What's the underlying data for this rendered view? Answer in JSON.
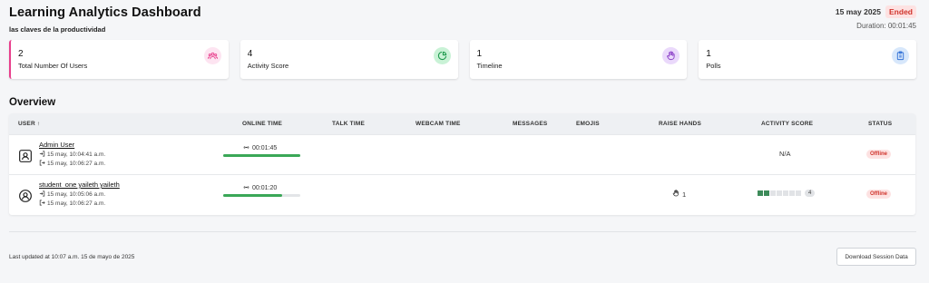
{
  "header": {
    "title": "Learning Analytics Dashboard",
    "subtitle": "las claves de la productividad",
    "date": "15 may 2025",
    "status_badge": "Ended",
    "duration": "Duration: 00:01:45"
  },
  "cards": [
    {
      "value": "2",
      "label": "Total Number Of Users",
      "icon": "users-icon",
      "color": "#e83e8c",
      "bg": "#fde4f1"
    },
    {
      "value": "4",
      "label": "Activity Score",
      "icon": "pie-chart-icon",
      "color": "#1e9a4d",
      "bg": "#c9f2d6"
    },
    {
      "value": "1",
      "label": "Timeline",
      "icon": "raise-hand-icon",
      "color": "#8e44c9",
      "bg": "#ead9fb"
    },
    {
      "value": "1",
      "label": "Polls",
      "icon": "clipboard-icon",
      "color": "#2f6fd6",
      "bg": "#d7e7fb"
    }
  ],
  "overview": {
    "title": "Overview"
  },
  "table": {
    "headers": {
      "user": "USER ↑",
      "online_time": "ONLINE TIME",
      "talk_time": "TALK TIME",
      "webcam_time": "WEBCAM TIME",
      "messages": "MESSAGES",
      "emojis": "EMOJIS",
      "raise_hands": "RAISE HANDS",
      "activity_score": "ACTIVITY SCORE",
      "status": "STATUS"
    },
    "rows": [
      {
        "name": "Admin User",
        "joined": "15 may, 10:04:41 a.m.",
        "left": "15 may, 10:06:27 a.m.",
        "online_time": "00:01:45",
        "online_fraction": 1.0,
        "activity_score": "N/A",
        "status": "Offline"
      },
      {
        "name": "student_one yaileth yaileth",
        "joined": "15 may, 10:05:06 a.m.",
        "left": "15 may, 10:06:27 a.m.",
        "online_time": "00:01:20",
        "online_fraction": 0.77,
        "raise_hands": "1",
        "activity_score": "4",
        "activity_level": 2,
        "activity_max": 7,
        "status": "Offline"
      }
    ]
  },
  "footer": {
    "last_updated": "Last updated at 10:07 a.m. 15 de mayo de 2025",
    "download_label": "Download Session Data"
  }
}
